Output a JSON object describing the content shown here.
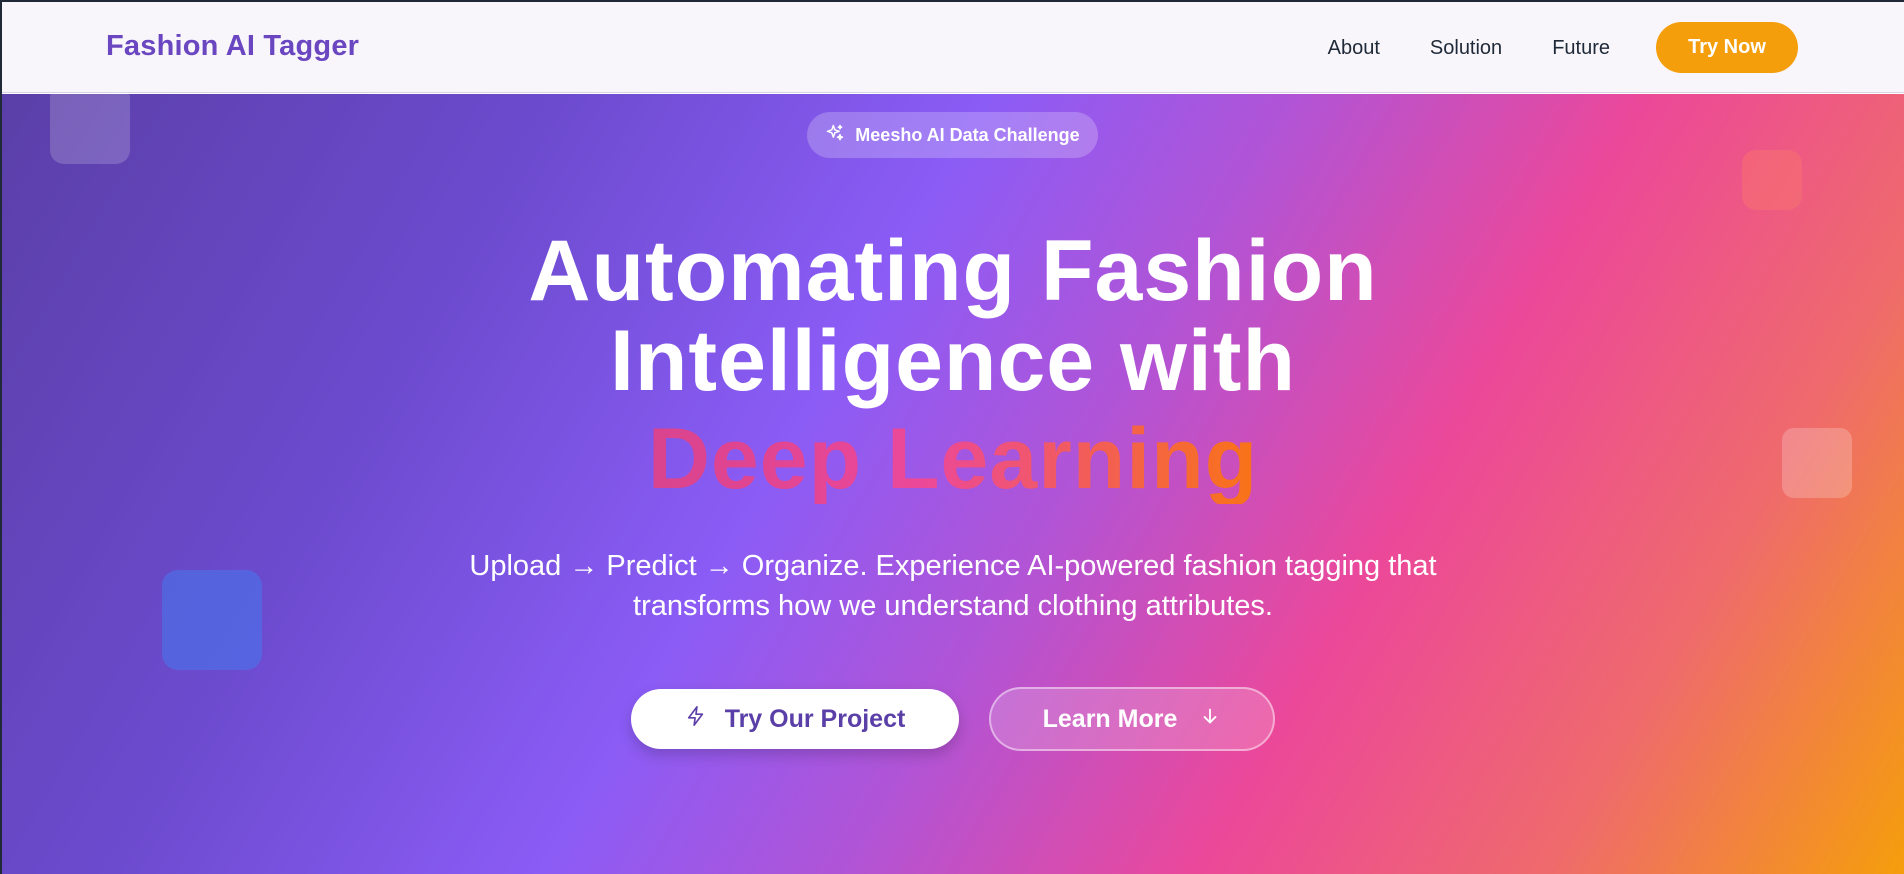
{
  "navbar": {
    "brand": "Fashion AI Tagger",
    "links": [
      "About",
      "Solution",
      "Future"
    ],
    "cta_label": "Try Now"
  },
  "hero": {
    "badge": {
      "icon": "sparkles-icon",
      "label": "Meesho AI Data Challenge"
    },
    "headline": {
      "line1": "Automating Fashion",
      "line2": "Intelligence with",
      "highlight": "Deep Learning"
    },
    "subtitle": {
      "line1": "Upload → Predict → Organize. Experience AI-powered fashion tagging that",
      "line2": "transforms how we understand clothing attributes."
    },
    "buttons": {
      "primary_label": "Try Our Project",
      "primary_icon": "lightning-icon",
      "secondary_label": "Learn More",
      "secondary_icon": "arrow-down-icon"
    }
  },
  "colors": {
    "brand": "#6b46c1",
    "cta": "#f59e0b",
    "gradient_start": "#5b3fa8",
    "gradient_mid": "#8b5cf6",
    "gradient_pink": "#ec4899",
    "gradient_end": "#f59e0b"
  }
}
